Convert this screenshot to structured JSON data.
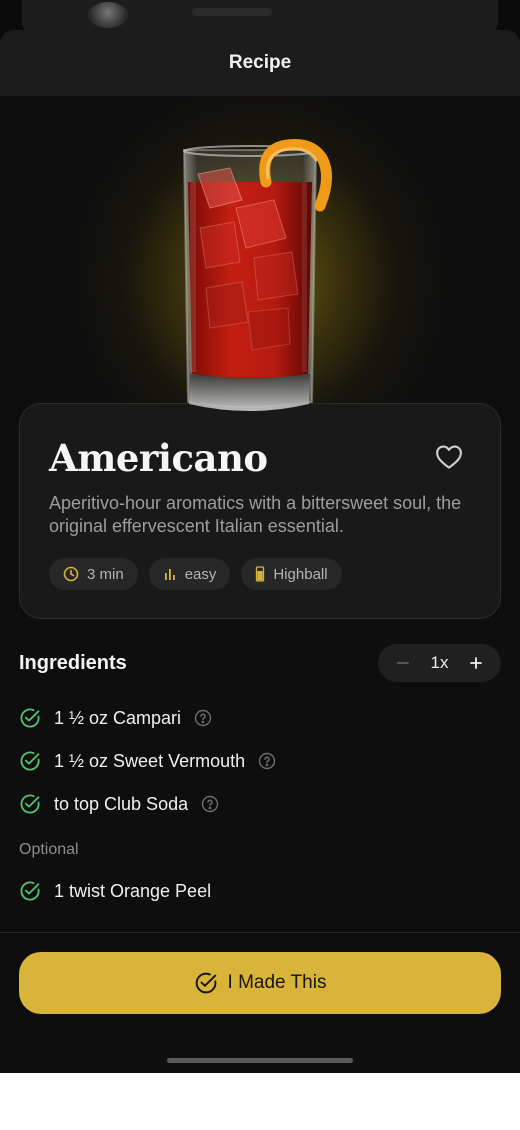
{
  "header": {
    "title": "Recipe"
  },
  "recipe": {
    "name": "Americano",
    "description": "Aperitivo-hour aromatics with a bittersweet soul, the original effervescent Italian essential.",
    "chips": [
      {
        "icon": "clock-icon",
        "label": "3 min"
      },
      {
        "icon": "difficulty-bars-icon",
        "label": "easy"
      },
      {
        "icon": "highball-glass-icon",
        "label": "Highball"
      }
    ]
  },
  "ingredients": {
    "title": "Ingredients",
    "multiplier": "1x",
    "items": [
      {
        "text": "1 ½ oz Campari"
      },
      {
        "text": "1 ½ oz Sweet Vermouth"
      },
      {
        "text": "to top Club Soda"
      }
    ],
    "optional_label": "Optional",
    "optional_items": [
      {
        "text": "1 twist Orange Peel"
      }
    ]
  },
  "action": {
    "label": "I Made This"
  },
  "colors": {
    "accent": "#d8b43a",
    "check_green": "#56c271",
    "background": "#0e0e0e",
    "card": "#191919"
  }
}
